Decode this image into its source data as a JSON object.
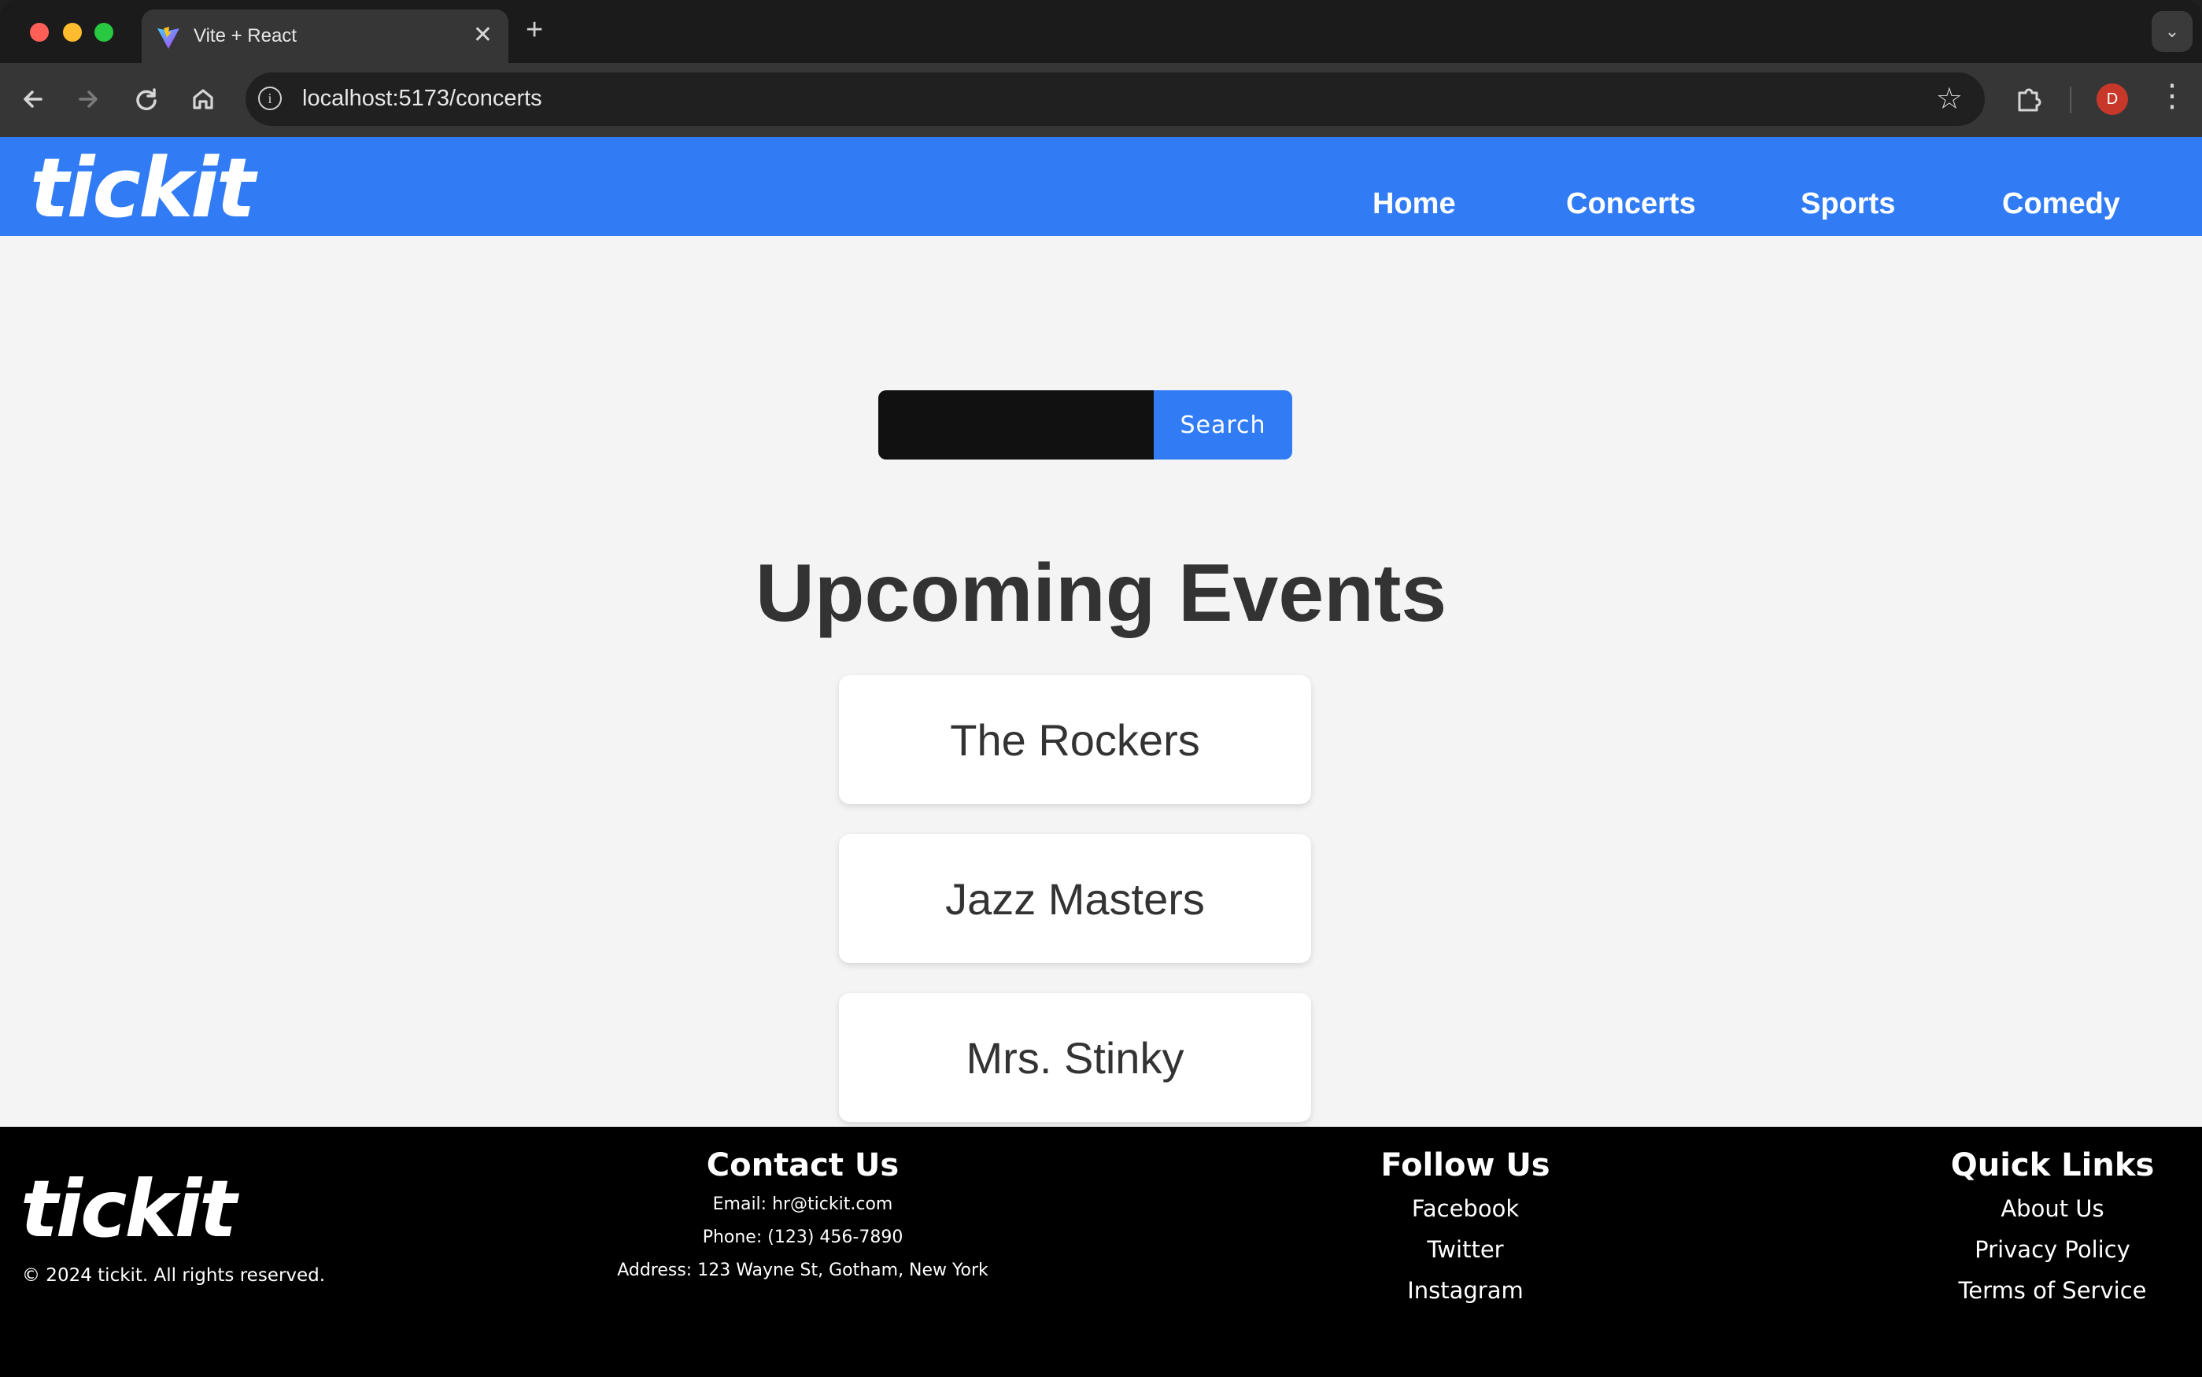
{
  "browser": {
    "tab_title": "Vite + React",
    "url": "localhost:5173/concerts",
    "profile_initial": "D",
    "icons": [
      "back-icon",
      "forward-icon",
      "reload-icon",
      "home-icon",
      "info-icon",
      "star-icon",
      "extensions-icon",
      "menu-icon"
    ]
  },
  "site": {
    "logo": "tickit",
    "nav": [
      {
        "label": "Home"
      },
      {
        "label": "Concerts"
      },
      {
        "label": "Sports"
      },
      {
        "label": "Comedy"
      }
    ],
    "colors": {
      "brand": "#317cf5",
      "footer": "#000000"
    }
  },
  "search": {
    "value": "",
    "button_label": "Search"
  },
  "events": {
    "title": "Upcoming Events",
    "items": [
      {
        "name": "The Rockers"
      },
      {
        "name": "Jazz Masters"
      },
      {
        "name": "Mrs. Stinky"
      }
    ]
  },
  "footer": {
    "logo": "tickit",
    "copyright": "© 2024 tickit. All rights reserved.",
    "contact": {
      "heading": "Contact Us",
      "email": "Email: hr@tickit.com",
      "phone": "Phone: (123) 456-7890",
      "address": "Address: 123 Wayne St, Gotham, New York"
    },
    "follow": {
      "heading": "Follow Us",
      "links": [
        "Facebook",
        "Twitter",
        "Instagram"
      ]
    },
    "quick": {
      "heading": "Quick Links",
      "links": [
        "About Us",
        "Privacy Policy",
        "Terms of Service"
      ]
    }
  }
}
